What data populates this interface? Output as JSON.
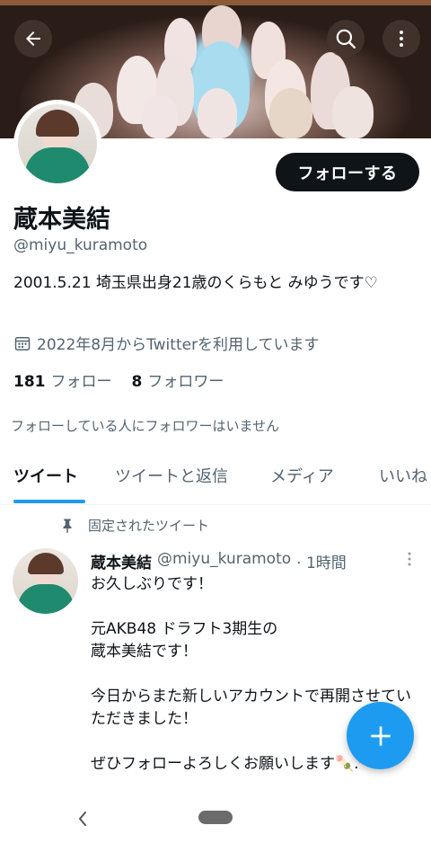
{
  "header": {
    "back_icon": "arrow-left-icon",
    "search_icon": "search-icon",
    "more_icon": "more-vertical-icon"
  },
  "profile": {
    "follow_label": "フォローする",
    "display_name": "蔵本美結",
    "handle": "@miyu_kuramoto",
    "bio": "2001.5.21 埼玉県出身21歳のくらもと みゆうです♡",
    "joined": "2022年8月からTwitterを利用しています",
    "following_count": "181",
    "following_label": "フォロー",
    "followers_count": "8",
    "followers_label": "フォロワー",
    "mutual_note": "フォローしている人にフォロワーはいません"
  },
  "tabs": [
    {
      "label": "ツイート",
      "active": true
    },
    {
      "label": "ツイートと返信",
      "active": false
    },
    {
      "label": "メディア",
      "active": false
    },
    {
      "label": "いいね",
      "active": false
    }
  ],
  "tweet": {
    "pinned_label": "固定されたツイート",
    "name": "蔵本美結",
    "handle": "@miyu_kuramoto",
    "time": "· 1時間",
    "body": "お久しぶりです！\n\n元AKB48 ドラフト3期生の\n蔵本美結です！\n\n今日からまた新しいアカウントで再開させていただきました！\n\nぜひフォローよろしくお願いします🍡.*"
  },
  "colors": {
    "accent": "#1d9bf0",
    "text_primary": "#0f1419",
    "text_secondary": "#536471",
    "follow_button_bg": "#0f1419"
  }
}
